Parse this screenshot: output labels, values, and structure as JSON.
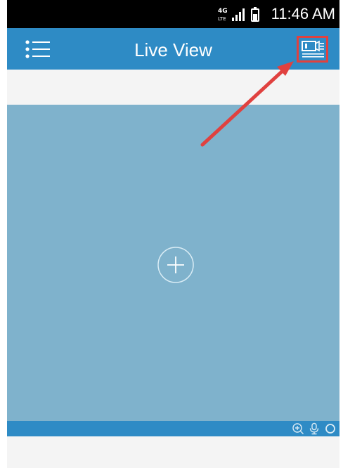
{
  "status_bar": {
    "time": "11:46 AM",
    "network_label": "4G LTE"
  },
  "header": {
    "title": "Live View"
  },
  "icons": {
    "menu": "list-menu-icon",
    "device_list": "device-list-icon",
    "add": "plus-circle-icon",
    "zoom": "zoom-in-icon",
    "mic": "microphone-icon",
    "record": "circle-icon"
  },
  "colors": {
    "header": "#2e8bc5",
    "live_panel": "#7fb2cc",
    "highlight": "#e0413f",
    "status_bar": "#000000"
  }
}
